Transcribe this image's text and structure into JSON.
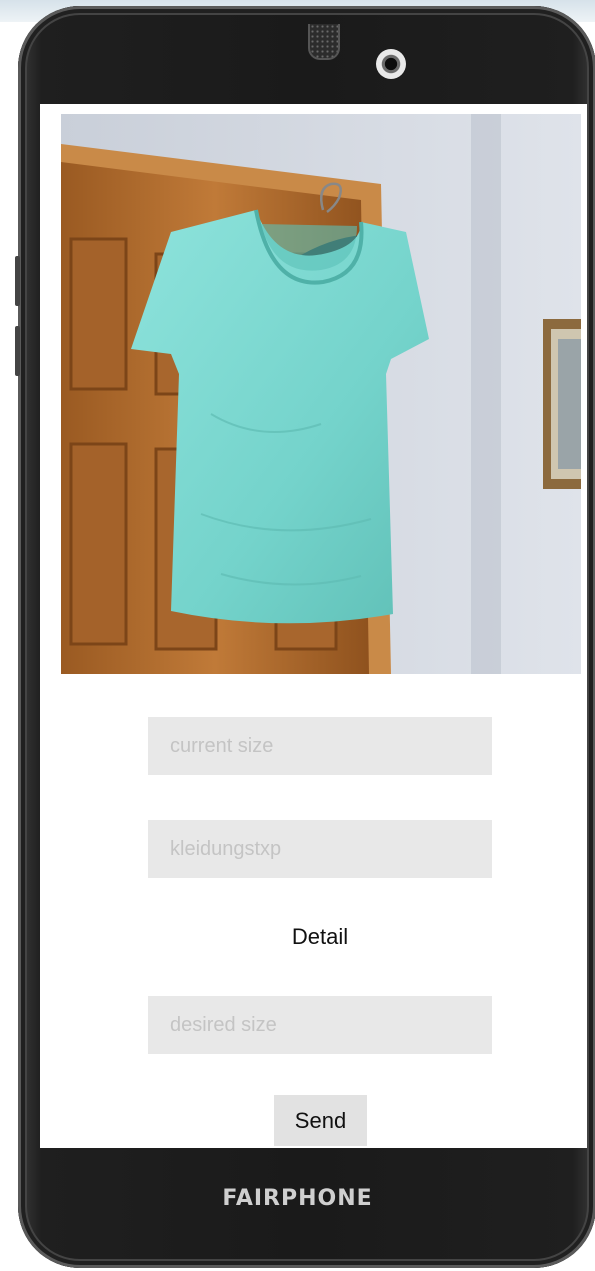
{
  "form": {
    "current_size_placeholder": "current size",
    "clothing_type_placeholder": "kleidungstxp",
    "detail_label": "Detail",
    "desired_size_placeholder": "desired size",
    "send_label": "Send"
  },
  "device": {
    "brand": "FAIRPHONE"
  },
  "colors": {
    "shirt": "#7ed9d2",
    "door": "#b8702f",
    "wall": "#d8dde6",
    "field_bg": "#e8e8e8",
    "button_bg": "#e2e2e2"
  }
}
